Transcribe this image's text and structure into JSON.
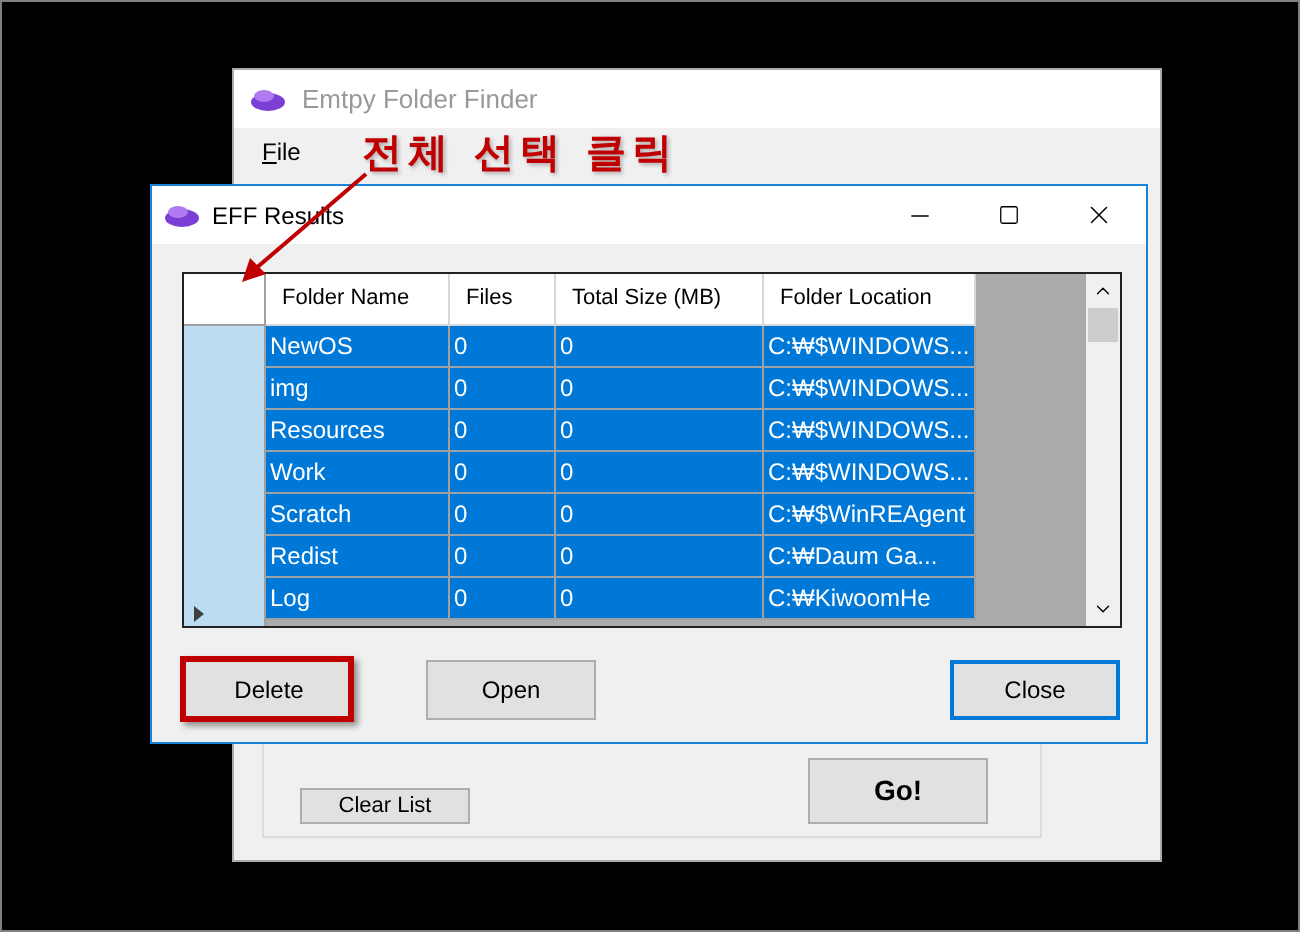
{
  "back_window": {
    "title": "Emtpy Folder Finder",
    "menu": [
      {
        "label": "File"
      }
    ],
    "buttons": [
      {
        "label": "Clear List",
        "kind": "plain"
      },
      {
        "label": "Go!",
        "kind": "bold"
      }
    ]
  },
  "dialog": {
    "title": "EFF Results",
    "table": {
      "columns": [
        "Folder Name",
        "Files",
        "Total Size (MB)",
        "Folder Location"
      ],
      "rows": [
        {
          "cells": [
            "NewOS",
            "0",
            "0",
            "C:₩$WINDOWS..."
          ],
          "selected": true
        },
        {
          "cells": [
            "img",
            "0",
            "0",
            "C:₩$WINDOWS..."
          ],
          "selected": true
        },
        {
          "cells": [
            "Resources",
            "0",
            "0",
            "C:₩$WINDOWS..."
          ],
          "selected": true
        },
        {
          "cells": [
            "Work",
            "0",
            "0",
            "C:₩$WINDOWS..."
          ],
          "selected": true
        },
        {
          "cells": [
            "Scratch",
            "0",
            "0",
            "C:₩$WinREAgent"
          ],
          "selected": true
        },
        {
          "cells": [
            "Redist",
            "0",
            "0",
            "C:₩Daum Ga..."
          ],
          "selected": true
        },
        {
          "cells": [
            "Log",
            "0",
            "0",
            "C:₩KiwoomHe"
          ],
          "selected": true
        }
      ]
    },
    "buttons": [
      {
        "label": "Delete",
        "default": false,
        "highlighted": true
      },
      {
        "label": "Open",
        "default": false,
        "highlighted": false
      },
      {
        "label": "Close",
        "default": true,
        "highlighted": false
      }
    ]
  },
  "annotation": {
    "text": "전체 선택 클릭"
  }
}
